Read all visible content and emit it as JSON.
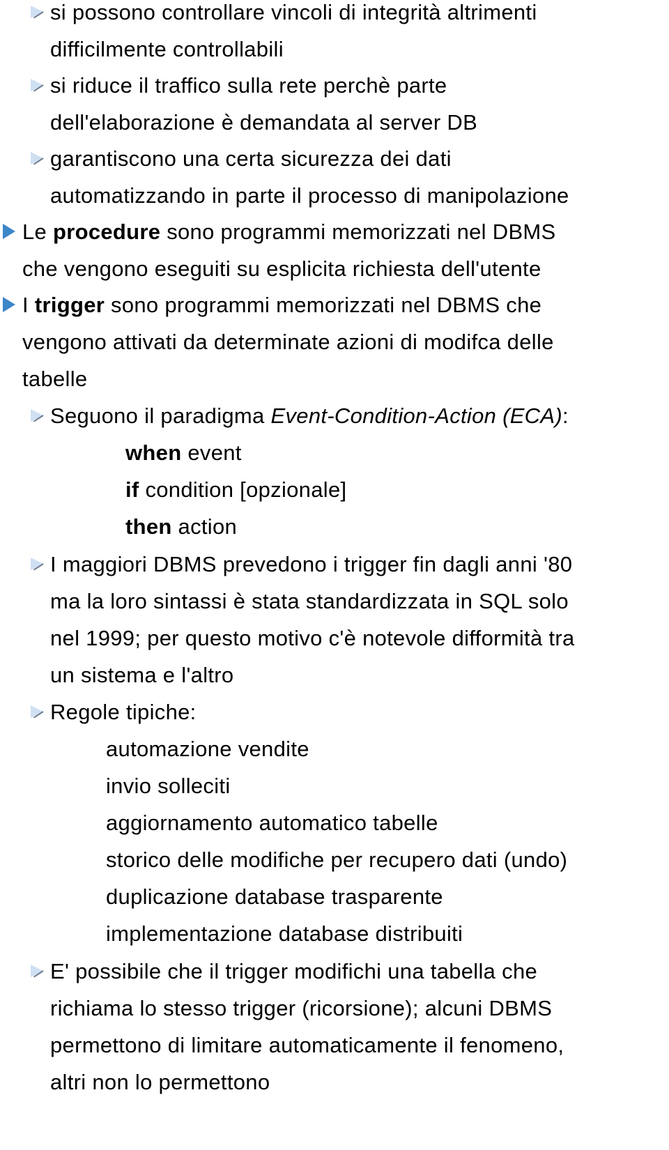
{
  "bullets_top": [
    {
      "lines": [
        "si possono controllare vincoli di integrità altrimenti",
        "difficilmente controllabili"
      ]
    },
    {
      "lines": [
        "si riduce il traffico sulla rete perchè parte",
        "dell'elaborazione è demandata al server DB"
      ]
    },
    {
      "lines": [
        "garantiscono una certa sicurezza dei dati",
        "automatizzando in parte il processo di manipolazione"
      ]
    }
  ],
  "procedure": {
    "prefix": "Le ",
    "bold": "procedure",
    "rest": " sono programmi memorizzati nel DBMS",
    "line2": "che vengono eseguiti su esplicita richiesta dell'utente"
  },
  "trigger": {
    "prefix": "I ",
    "bold": "trigger",
    "rest": " sono programmi memorizzati nel DBMS che",
    "line2": "vengono attivati da determinate azioni di modifca delle",
    "line3": "tabelle"
  },
  "eca": {
    "intro": "Seguono il paradigma ",
    "intro_italic": "Event-Condition-Action (ECA)",
    "intro_end": ":",
    "rules": [
      {
        "kw": "when",
        "text": " event"
      },
      {
        "kw": "if",
        "text": " condition [opzionale]"
      },
      {
        "kw": "then",
        "text": " action"
      }
    ]
  },
  "history": {
    "lines": [
      "I maggiori DBMS prevedono i trigger fin dagli anni '80",
      "ma la loro sintassi è stata standardizzata in SQL solo",
      "nel 1999; per questo motivo c'è notevole difformità tra",
      "un sistema e l'altro"
    ]
  },
  "regole": {
    "title": "Regole tipiche:",
    "items": [
      "automazione vendite",
      "invio solleciti",
      "aggiornamento automatico tabelle",
      "storico delle modifiche per recupero dati (undo)",
      "duplicazione database trasparente",
      "implementazione database distribuiti"
    ]
  },
  "ricorsione": {
    "lines": [
      "E' possibile che il trigger modifichi una tabella che",
      "richiama lo stesso trigger (ricorsione); alcuni DBMS",
      "permettono di limitare automaticamente il fenomeno,",
      "altri non lo permettono"
    ]
  }
}
